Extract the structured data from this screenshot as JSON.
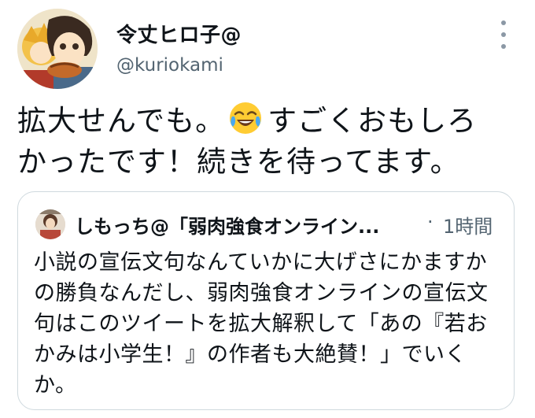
{
  "author": {
    "display_name": "令丈ヒロ子@",
    "handle": "@kuriokami"
  },
  "tweet": {
    "line1_before": "拡大せんでも。",
    "emoji": "face-with-tears-of-joy",
    "line1_after": "すごくおもしろ",
    "line2": "かったです！続きを待ってます。"
  },
  "quoted": {
    "display_name": "しもっち@「弱肉強食オンライン...",
    "separator": "·",
    "time": "1時間",
    "lines": [
      "小説の宣伝文句なんていかに大げさにかますか",
      "の勝負なんだし、弱肉強食オンラインの宣伝文",
      "句はこのツイートを拡大解釈して「あの『若お",
      "かみは小学生！』の作者も大絶賛！」でいく",
      "か。"
    ]
  },
  "colors": {
    "text": "#0f1419",
    "secondary": "#536471",
    "border": "#cfd9de"
  }
}
